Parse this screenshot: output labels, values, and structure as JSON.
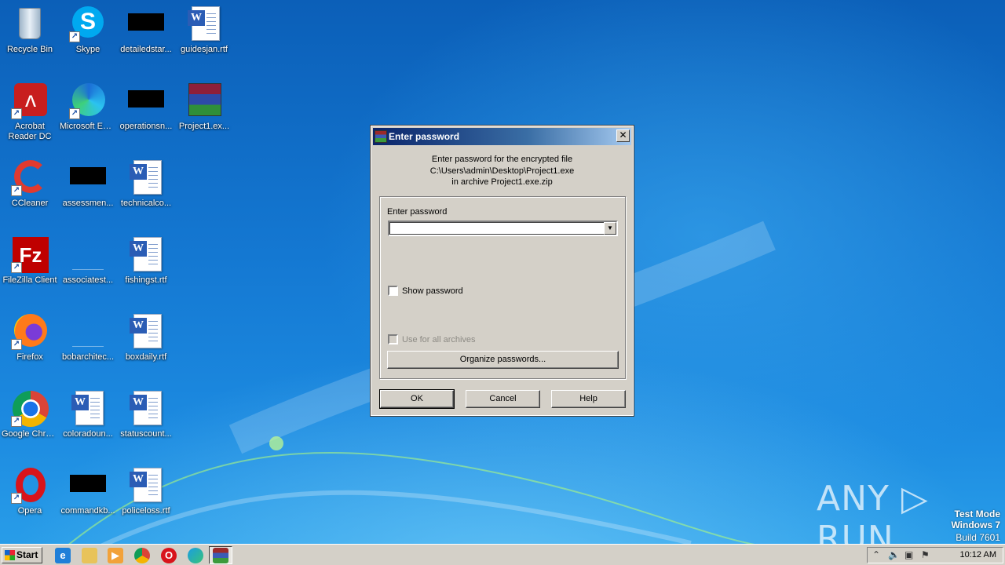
{
  "desktop": {
    "icons": [
      {
        "label": "Recycle Bin",
        "icon": "recycle-bin-icon"
      },
      {
        "label": "Skype",
        "icon": "skype-icon"
      },
      {
        "label": "detailedstar...",
        "icon": "redacted-file-icon"
      },
      {
        "label": "guidesjan.rtf",
        "icon": "word-doc-icon"
      },
      {
        "label": "Acrobat Reader DC",
        "icon": "acrobat-icon"
      },
      {
        "label": "Microsoft Edge",
        "icon": "edge-icon"
      },
      {
        "label": "operationsn...",
        "icon": "redacted-file-icon"
      },
      {
        "label": "Project1.ex...",
        "icon": "winrar-archive-icon"
      },
      {
        "label": "CCleaner",
        "icon": "ccleaner-icon"
      },
      {
        "label": "assessmen...",
        "icon": "redacted-file-icon"
      },
      {
        "label": "technicalco...",
        "icon": "word-doc-icon"
      },
      {
        "label": "FileZilla Client",
        "icon": "filezilla-icon"
      },
      {
        "label": "associatest...",
        "icon": "blank-file-icon"
      },
      {
        "label": "fishingst.rtf",
        "icon": "word-doc-icon"
      },
      {
        "label": "Firefox",
        "icon": "firefox-icon"
      },
      {
        "label": "bobarchitec...",
        "icon": "blank-file-icon"
      },
      {
        "label": "boxdaily.rtf",
        "icon": "word-doc-icon"
      },
      {
        "label": "Google Chrome",
        "icon": "chrome-icon"
      },
      {
        "label": "coloradoun...",
        "icon": "word-doc-icon"
      },
      {
        "label": "statuscount...",
        "icon": "word-doc-icon"
      },
      {
        "label": "Opera",
        "icon": "opera-icon"
      },
      {
        "label": "commandkb...",
        "icon": "redacted-file-icon"
      },
      {
        "label": "policeloss.rtf",
        "icon": "word-doc-icon"
      }
    ]
  },
  "dialog": {
    "title": "Enter password",
    "info_line1": "Enter password for the encrypted file",
    "info_line2": "C:\\Users\\admin\\Desktop\\Project1.exe",
    "info_line3": "in archive Project1.exe.zip",
    "password_label": "Enter password",
    "password_value": "",
    "show_password_label": "Show password",
    "use_all_label": "Use for all archives",
    "organize_label": "Organize passwords...",
    "ok_label": "OK",
    "cancel_label": "Cancel",
    "help_label": "Help",
    "close_glyph": "✕"
  },
  "taskbar": {
    "start_label": "Start",
    "clock": "10:12 AM"
  },
  "watermark": {
    "line1": "Test Mode",
    "line2": "Windows 7",
    "line3": "Build 7601",
    "brand": "ANY ▷ RUN"
  }
}
